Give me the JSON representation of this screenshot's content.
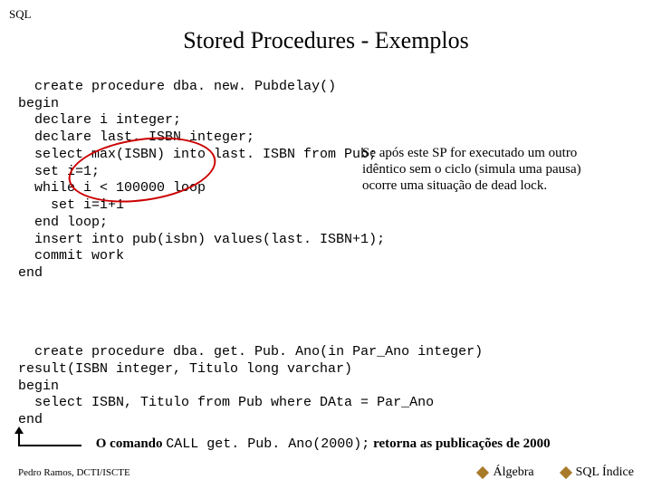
{
  "cornerLabel": "SQL",
  "title": "Stored Procedures - Exemplos",
  "code1": "create procedure dba. new. Pubdelay()\nbegin\n  declare i integer;\n  declare last. ISBN integer;\n  select max(ISBN) into last. ISBN from Pub;\n  set i=1;\n  while i < 100000 loop\n    set i=i+1\n  end loop;\n  insert into pub(isbn) values(last. ISBN+1);\n  commit work\nend",
  "annotation": "Se após este SP for executado um outro idêntico sem o ciclo (simula uma pausa) ocorre uma situação de dead lock.",
  "code2": "create procedure dba. get. Pub. Ano(in Par_Ano integer)\nresult(ISBN integer, Titulo long varchar)\nbegin\n  select ISBN, Titulo from Pub where DAta = Par_Ano\nend",
  "captionPrefix": "O comando ",
  "captionMono": "CALL get. Pub. Ano(2000);",
  "captionSuffix": " retorna as publicações de 2000",
  "footer": {
    "left": "Pedro Ramos, DCTI/ISCTE",
    "link1": "Álgebra",
    "link2": "SQL Índice"
  }
}
